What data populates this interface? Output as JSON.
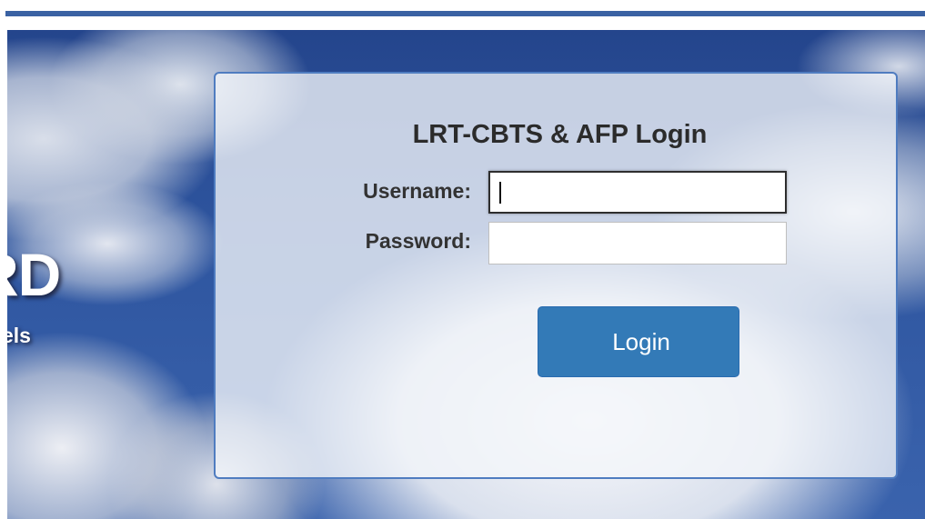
{
  "branding": {
    "title_fragment": "RD",
    "subtitle_fragment": "els"
  },
  "login": {
    "title": "LRT-CBTS & AFP Login",
    "username_label": "Username:",
    "username_value": "",
    "password_label": "Password:",
    "password_value": "",
    "submit_label": "Login"
  },
  "colors": {
    "top_bar": "#3a62a3",
    "panel_border": "#4f7cc0",
    "button_bg": "#337ab7",
    "button_text": "#ffffff"
  }
}
